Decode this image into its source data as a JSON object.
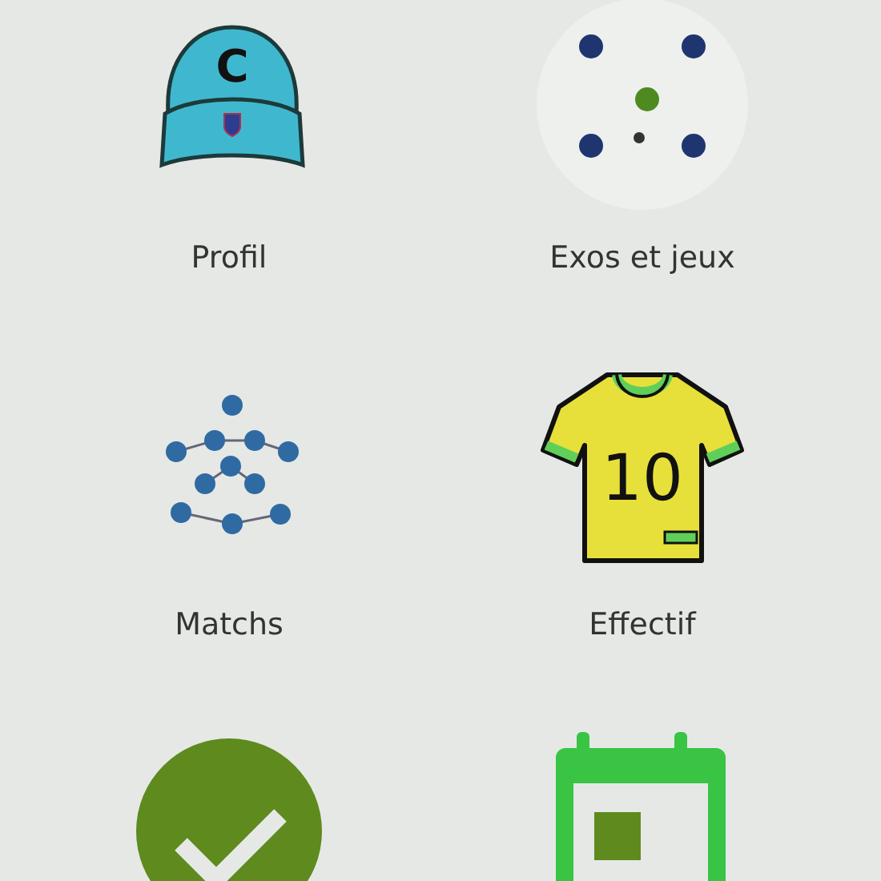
{
  "tiles": [
    {
      "kind": "cap",
      "label": "Profil",
      "letter": "C"
    },
    {
      "kind": "tactic",
      "label": "Exos et jeux"
    },
    {
      "kind": "network",
      "label": "Matchs"
    },
    {
      "kind": "jersey",
      "label": "Effectif",
      "number": "10"
    },
    {
      "kind": "check"
    },
    {
      "kind": "calendar"
    }
  ]
}
